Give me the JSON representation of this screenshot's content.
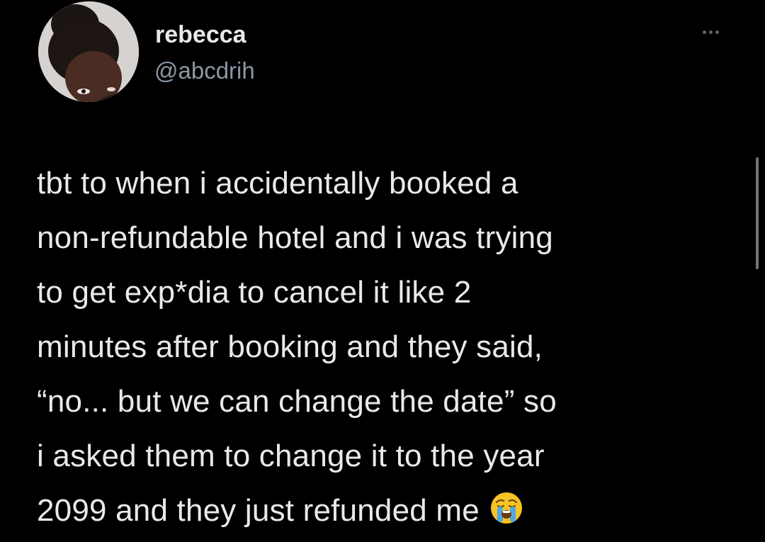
{
  "tweet": {
    "author": {
      "display_name": "rebecca",
      "handle": "@abcdrih"
    },
    "text_lines": [
      "tbt to when i accidentally booked a",
      "non-refundable hotel and i was trying",
      "to get exp*dia to cancel it like 2",
      "minutes after booking and they said,",
      "“no... but we can change the date” so",
      "i asked them to change it to the year",
      "2099 and they just refunded me"
    ],
    "emoji": "loudly-crying-face-emoji",
    "more_icon": "more-horizontal-icon"
  },
  "colors": {
    "background": "#000000",
    "text": "#e7e9ea",
    "secondary_text": "#8b98a5"
  }
}
